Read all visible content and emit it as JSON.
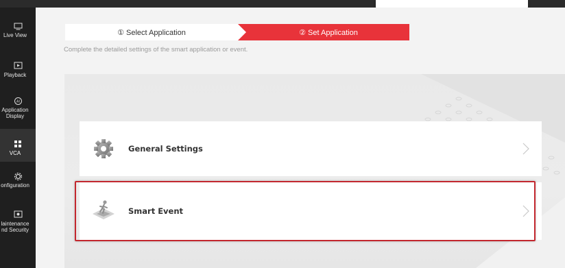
{
  "sidebar": {
    "items": [
      {
        "label": "Live View",
        "icon": "monitor-icon"
      },
      {
        "label": "Playback",
        "icon": "play-icon"
      },
      {
        "label": "Application\nDisplay",
        "icon": "ai-icon"
      },
      {
        "label": "VCA",
        "icon": "grid-icon",
        "active": true
      },
      {
        "label": "onfiguration",
        "icon": "gear-icon"
      },
      {
        "label": "laintenance\nnd Security",
        "icon": "shield-icon"
      }
    ]
  },
  "steps": {
    "step1": "① Select Application",
    "step2": "② Set Application"
  },
  "hint": "Complete the detailed settings of the smart application or event.",
  "cards": {
    "general": "General Settings",
    "smart": "Smart Event"
  },
  "colors": {
    "accent": "#e8333a",
    "highlight": "#c3272e",
    "sidebar": "#1f1f1f"
  }
}
